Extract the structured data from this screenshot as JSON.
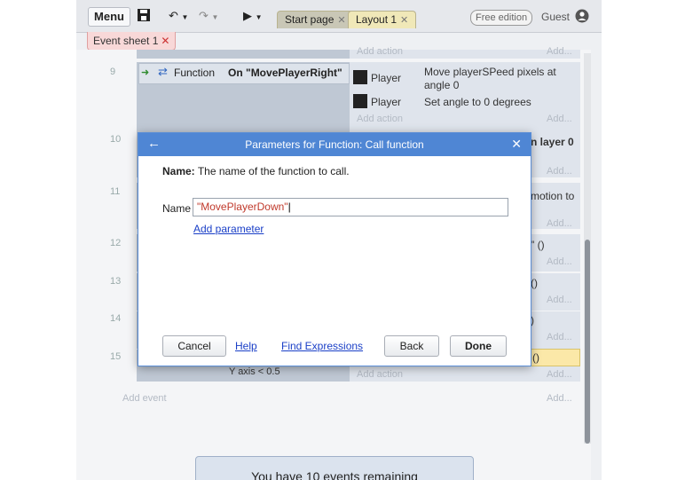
{
  "toolbar": {
    "menu_label": "Menu",
    "tabs": [
      {
        "label": "Start page",
        "color": "#c9c7b6"
      },
      {
        "label": "Layout 1",
        "color": "#f0e8b8"
      }
    ],
    "edition_badge": "Free edition",
    "user_label": "Guest"
  },
  "sheet_tab": {
    "label": "Event sheet 1"
  },
  "events": [
    {
      "number": "9",
      "condition_object": "Function",
      "condition_text": "On \"MovePlayerRight\"",
      "actions": [
        {
          "object": "Player",
          "text_line1": "Move playerSPeed pixels at",
          "text_line2": "angle 0"
        },
        {
          "object": "Player",
          "text_line1": "Set angle to 0 degrees",
          "text_line2": ""
        }
      ]
    },
    {
      "number": "10",
      "fragment": "n layer 0"
    },
    {
      "number": "11",
      "fragment": "motion to"
    },
    {
      "number": "12",
      "fragment": "\" ()"
    },
    {
      "number": "13",
      "fragment": "()"
    },
    {
      "number": "14",
      "fragment": ")"
    },
    {
      "number": "15",
      "fragment": "()",
      "condition_fragment": "Y axis < 0.5"
    }
  ],
  "add_action": "Add action",
  "add_short": "Add...",
  "add_event": "Add event",
  "banner": "You have 10 events remaining",
  "dialog": {
    "title": "Parameters for Function: Call function",
    "description_label": "Name:",
    "description_text": "The name of the function to call.",
    "field_label": "Name",
    "field_value": "\"MovePlayerDown\"",
    "add_parameter": "Add parameter",
    "buttons": {
      "cancel": "Cancel",
      "help": "Help",
      "find_expressions": "Find Expressions",
      "back": "Back",
      "done": "Done"
    }
  }
}
